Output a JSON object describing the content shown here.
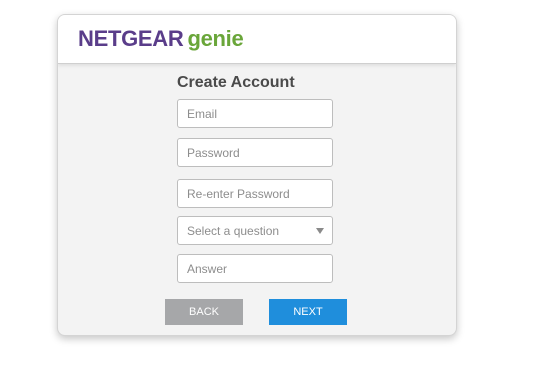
{
  "header": {
    "brand_main": "NETGEAR",
    "brand_genie": "genie"
  },
  "form": {
    "title": "Create Account",
    "email_placeholder": "Email",
    "password_placeholder": "Password",
    "reenter_password_placeholder": "Re-enter Password",
    "question_select_value": "Select a question",
    "answer_placeholder": "Answer"
  },
  "buttons": {
    "back_label": "BACK",
    "next_label": "NEXT"
  },
  "colors": {
    "brand_purple": "#5a3d8a",
    "brand_green": "#6aa63a",
    "back_button": "#a6a7a9",
    "next_button": "#1f8edc"
  },
  "icons": {
    "select_arrow": "chevron-down-icon"
  }
}
